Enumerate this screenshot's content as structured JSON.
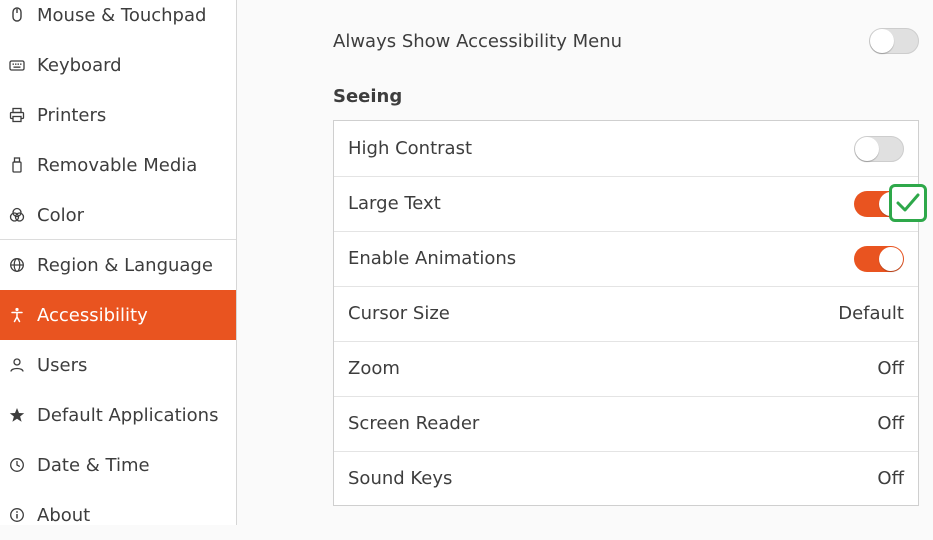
{
  "sidebar": {
    "items": [
      {
        "label": "Mouse & Touchpad",
        "icon": "mouse-icon"
      },
      {
        "label": "Keyboard",
        "icon": "keyboard-icon"
      },
      {
        "label": "Printers",
        "icon": "printer-icon"
      },
      {
        "label": "Removable Media",
        "icon": "removable-media-icon"
      },
      {
        "label": "Color",
        "icon": "color-icon"
      },
      {
        "label": "Region & Language",
        "icon": "globe-icon"
      },
      {
        "label": "Accessibility",
        "icon": "accessibility-icon",
        "active": true
      },
      {
        "label": "Users",
        "icon": "users-icon"
      },
      {
        "label": "Default Applications",
        "icon": "star-icon"
      },
      {
        "label": "Date & Time",
        "icon": "clock-icon"
      },
      {
        "label": "About",
        "icon": "info-icon"
      }
    ]
  },
  "main": {
    "always_show_label": "Always Show Accessibility Menu",
    "always_show_on": false,
    "section_title": "Seeing",
    "rows": [
      {
        "label": "High Contrast",
        "type": "switch",
        "on": false
      },
      {
        "label": "Large Text",
        "type": "switch",
        "on": true
      },
      {
        "label": "Enable Animations",
        "type": "switch",
        "on": true
      },
      {
        "label": "Cursor Size",
        "type": "value",
        "value": "Default"
      },
      {
        "label": "Zoom",
        "type": "value",
        "value": "Off"
      },
      {
        "label": "Screen Reader",
        "type": "value",
        "value": "Off"
      },
      {
        "label": "Sound Keys",
        "type": "value",
        "value": "Off"
      }
    ]
  },
  "colors": {
    "accent": "#e95420",
    "check_green": "#2ea84a"
  }
}
